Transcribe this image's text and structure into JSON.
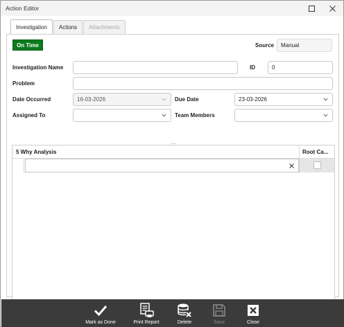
{
  "window": {
    "title": "Action Editor"
  },
  "tabs": [
    {
      "label": "Investigation",
      "active": true
    },
    {
      "label": "Actions",
      "active": false
    },
    {
      "label": "Attachments",
      "disabled": true
    }
  ],
  "form": {
    "status_badge": "On Time",
    "status_color": "#0a7a1e",
    "source_label": "Source",
    "source_value": "Manual",
    "investigation_name_label": "Investigation Name",
    "investigation_name_value": "",
    "id_label": "ID",
    "id_value": "0",
    "problem_label": "Problem",
    "problem_value": "",
    "date_occurred_label": "Date Occurred",
    "date_occurred_value": "16-03-2026",
    "due_date_label": "Due Date",
    "due_date_value": "23-03-2026",
    "assigned_to_label": "Assigned To",
    "assigned_to_value": "",
    "team_members_label": "Team Members",
    "team_members_value": "",
    "splitter": "..."
  },
  "grid": {
    "columns": [
      "5 Why Analysis",
      "Root Ca..."
    ],
    "rows": [
      {
        "analysis": "",
        "root_cause": false
      }
    ]
  },
  "toolbar": {
    "background": "#3b3b3b",
    "buttons": [
      {
        "label": "Mark as Done",
        "icon": "checkmark-icon"
      },
      {
        "label": "Print Report",
        "icon": "print-report-icon"
      },
      {
        "label": "Delete",
        "icon": "delete-database-icon"
      },
      {
        "label": "Save",
        "icon": "save-icon",
        "disabled": true
      },
      {
        "label": "Close",
        "icon": "close-box-icon"
      }
    ]
  }
}
